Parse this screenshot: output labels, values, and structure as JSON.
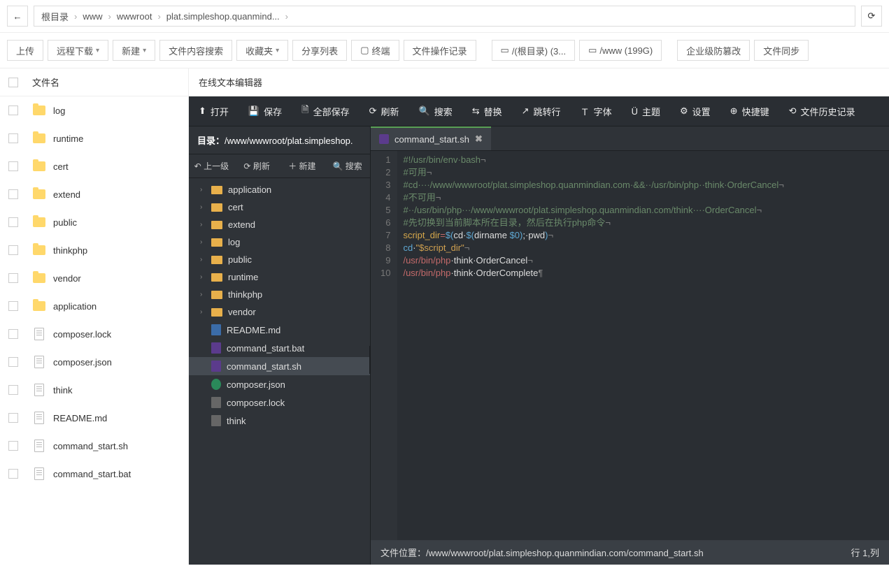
{
  "breadcrumb": [
    "根目录",
    "www",
    "wwwroot",
    "plat.simpleshop.quanmind..."
  ],
  "toolbar": {
    "upload": "上传",
    "remote_dl": "远程下载",
    "new": "新建",
    "content_search": "文件内容搜索",
    "favorites": "收藏夹",
    "share_list": "分享列表",
    "terminal": "终端",
    "file_ops": "文件操作记录",
    "disk_root": "/(根目录) (3...",
    "disk_www": "/www (199G)",
    "tamper": "企业级防篡改",
    "sync": "文件同步"
  },
  "filelist": {
    "header": "文件名",
    "items": [
      {
        "name": "log",
        "type": "folder"
      },
      {
        "name": "runtime",
        "type": "folder"
      },
      {
        "name": "cert",
        "type": "folder"
      },
      {
        "name": "extend",
        "type": "folder"
      },
      {
        "name": "public",
        "type": "folder"
      },
      {
        "name": "thinkphp",
        "type": "folder"
      },
      {
        "name": "vendor",
        "type": "folder"
      },
      {
        "name": "application",
        "type": "folder"
      },
      {
        "name": "composer.lock",
        "type": "file"
      },
      {
        "name": "composer.json",
        "type": "file"
      },
      {
        "name": "think",
        "type": "file"
      },
      {
        "name": "README.md",
        "type": "file"
      },
      {
        "name": "command_start.sh",
        "type": "file"
      },
      {
        "name": "command_start.bat",
        "type": "file"
      }
    ]
  },
  "editor": {
    "title": "在线文本编辑器",
    "toolbar": {
      "open": "打开",
      "save": "保存",
      "save_all": "全部保存",
      "refresh": "刷新",
      "search": "搜索",
      "replace": "替换",
      "goto": "跳转行",
      "font": "字体",
      "theme": "主题",
      "settings": "设置",
      "shortcuts": "快捷键",
      "history": "文件历史记录"
    },
    "path_label": "目录：",
    "path": "/www/wwwroot/plat.simpleshop.",
    "mini_tb": {
      "up": "上一级",
      "refresh": "刷新",
      "new": "新建",
      "search": "搜索"
    },
    "tree": [
      {
        "name": "application",
        "type": "folder"
      },
      {
        "name": "cert",
        "type": "folder"
      },
      {
        "name": "extend",
        "type": "folder"
      },
      {
        "name": "log",
        "type": "folder"
      },
      {
        "name": "public",
        "type": "folder"
      },
      {
        "name": "runtime",
        "type": "folder"
      },
      {
        "name": "thinkphp",
        "type": "folder"
      },
      {
        "name": "vendor",
        "type": "folder"
      },
      {
        "name": "README.md",
        "type": "md"
      },
      {
        "name": "command_start.bat",
        "type": "bat"
      },
      {
        "name": "command_start.sh",
        "type": "sh",
        "active": true
      },
      {
        "name": "composer.json",
        "type": "json"
      },
      {
        "name": "composer.lock",
        "type": "file"
      },
      {
        "name": "think",
        "type": "file"
      }
    ],
    "tab": {
      "name": "command_start.sh"
    },
    "code": [
      {
        "n": 1,
        "html": "<span class='c-comment'>#!/usr/bin/env·bash<span class='c-dim'>¬</span></span>"
      },
      {
        "n": 2,
        "html": "<span class='c-comment'>#可用<span class='c-dim'>¬</span></span>"
      },
      {
        "n": 3,
        "html": "<span class='c-comment'>#cd····/www/wwwroot/plat.simpleshop.quanmindian.com·&&··/usr/bin/php··think·OrderCancel<span class='c-dim'>¬</span></span>"
      },
      {
        "n": 4,
        "html": "<span class='c-comment'>#不可用<span class='c-dim'>¬</span></span>"
      },
      {
        "n": 5,
        "html": "<span class='c-comment'>#··/usr/bin/php···/www/wwwroot/plat.simpleshop.quanmindian.com/think····OrderCancel<span class='c-dim'>¬</span></span>"
      },
      {
        "n": 6,
        "html": "<span class='c-comment'>#先切换到当前脚本所在目录，然后在执行php命令<span class='c-dim'>¬</span></span>"
      },
      {
        "n": 7,
        "html": "<span class='c-var'>script_dir</span><span class='c-op'>=</span><span class='c-builtin'>$(</span><span class='c-white'>cd·</span><span class='c-builtin'>$(</span><span class='c-white'>dirname </span><span class='c-builtin'>$0)</span><span class='c-white'>;·pwd</span><span class='c-builtin'>)</span><span class='c-dim'>¬</span>"
      },
      {
        "n": 8,
        "html": "<span class='c-builtin'>cd</span><span class='c-white'>·</span><span class='c-str'>\"$script_dir\"</span><span class='c-dim'>¬</span>"
      },
      {
        "n": 9,
        "html": "<span class='c-path'>/usr/bin/php</span><span class='c-white'>·think·OrderCancel</span><span class='c-dim'>¬</span>"
      },
      {
        "n": 10,
        "html": "<span class='c-path'>/usr/bin/php</span><span class='c-white'>·think·OrderComplete</span><span class='c-dim'>¶</span>"
      }
    ],
    "status": {
      "loc_label": "文件位置：",
      "loc": "/www/wwwroot/plat.simpleshop.quanmindian.com/command_start.sh",
      "pos": "行 1,列"
    }
  }
}
